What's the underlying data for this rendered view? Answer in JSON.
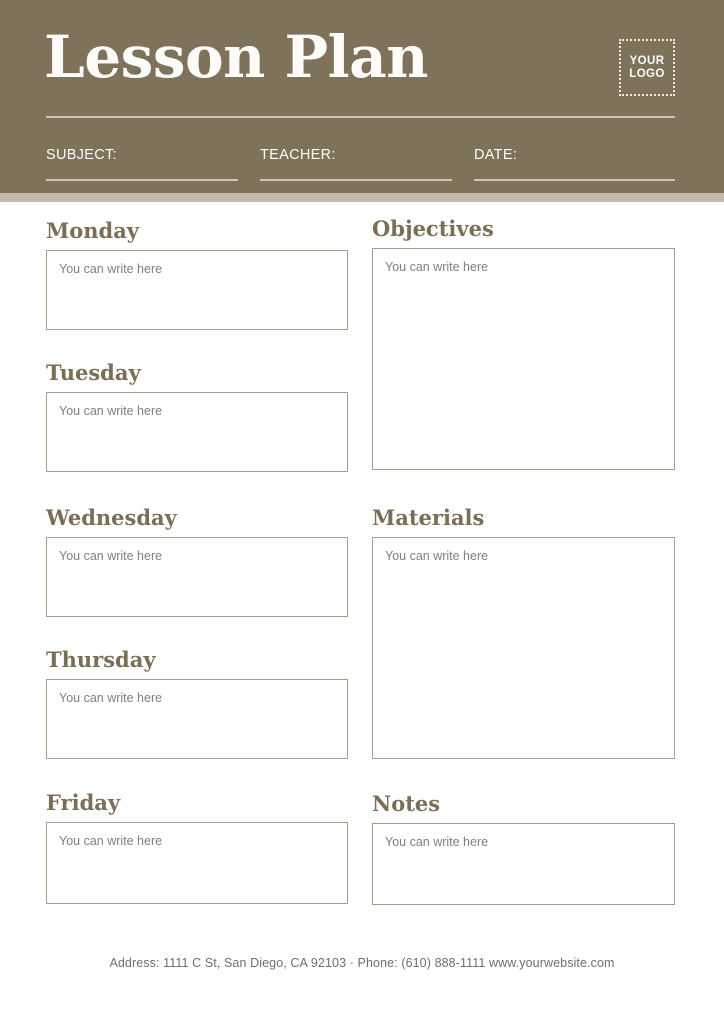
{
  "header": {
    "title": "Lesson Plan",
    "logo": {
      "line1": "YOUR",
      "line2": "LOGO"
    },
    "fields": [
      {
        "label": "SUBJECT:",
        "value": ""
      },
      {
        "label": "TEACHER:",
        "value": ""
      },
      {
        "label": "DATE:",
        "value": ""
      }
    ]
  },
  "colors": {
    "header_background": "#7f725a",
    "header_underband": "#c4bca8",
    "heading_text": "#7b6e57",
    "box_border": "#a79d89",
    "placeholder_text": "#808080",
    "page_background": "#ffffff",
    "title_text": "#fdfcf8"
  },
  "placeholder": "You can write here",
  "left_column": [
    {
      "title": "Monday",
      "placeholder": "You can write here"
    },
    {
      "title": "Tuesday",
      "placeholder": "You can write here"
    },
    {
      "title": "Wednesday",
      "placeholder": "You can write here"
    },
    {
      "title": "Thursday",
      "placeholder": "You can write here"
    },
    {
      "title": "Friday",
      "placeholder": "You can write here"
    }
  ],
  "right_column": [
    {
      "title": "Objectives",
      "placeholder": "You can write here"
    },
    {
      "title": "Materials",
      "placeholder": "You can write here"
    },
    {
      "title": "Notes",
      "placeholder": "You can write here"
    }
  ],
  "footer": {
    "text": "Address: 1111 C St, San Diego, CA 92103 · Phone: (610) 888-1111 www.yourwebsite.com"
  }
}
